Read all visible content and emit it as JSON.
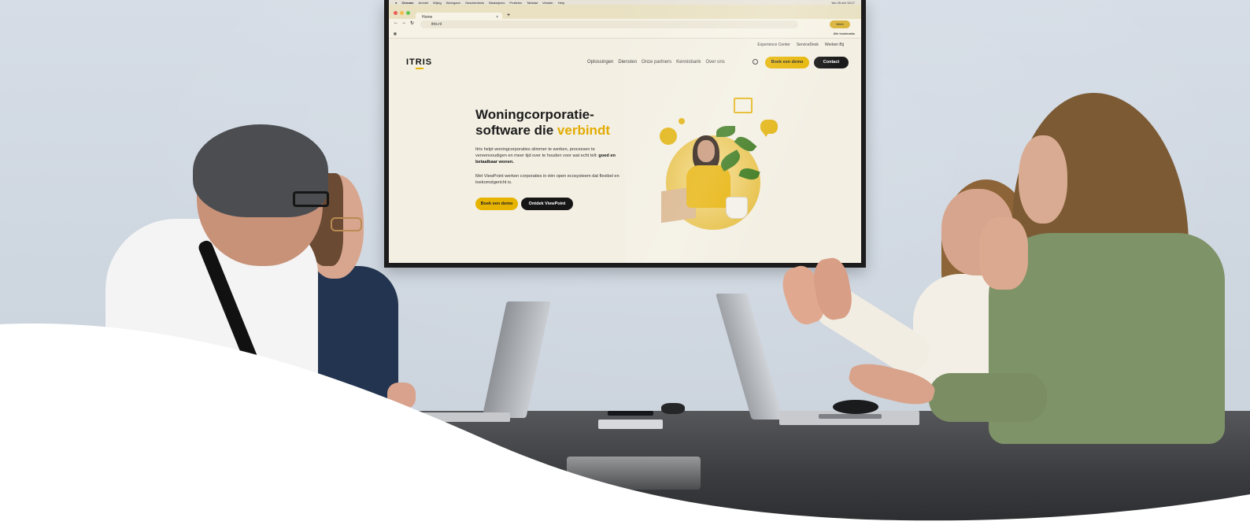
{
  "mac_menu": [
    "Chrome",
    "Archief",
    "Wijzig",
    "Weergave",
    "Geschiedenis",
    "Bladwijzers",
    "Profielen",
    "Tabblad",
    "Venster",
    "Help"
  ],
  "mac_status": "Wo 25 mrt 13:17",
  "browser": {
    "tab_title": "Home",
    "tab_close": "×",
    "new_tab": "+",
    "url": "itris.nl",
    "profile": "Werk",
    "bookmarks_label": "Alle bookmarks"
  },
  "site": {
    "logo": "ITRIS",
    "top_links": [
      "Experience Center",
      "ServiceDesk",
      "Werken Bij"
    ],
    "nav": [
      "Oplossingen",
      "Diensten",
      "Onze partners",
      "Kennisbank",
      "Over ons"
    ],
    "btn_demo": "Boek een demo",
    "btn_contact": "Contact",
    "hero": {
      "title_line1": "Woningcorporatie-",
      "title_line2_a": "software die ",
      "title_line2_b": "verbindt",
      "p1_a": "Itris helpt woningcorporaties slimmer te werken, processen te vereenvoudigen en meer tijd over te houden voor wat echt telt:",
      "p1_b": "goed en betaalbaar wonen.",
      "p2": "Met ViewPoint werken corporaties in één open ecosysteem dat flexibel en toekomstgericht is.",
      "btn_primary": "Boek een demo",
      "btn_secondary": "Ontdek ViewPoint"
    }
  },
  "colors": {
    "accent": "#e6b400",
    "dark": "#161616",
    "wall": "#d6dde6"
  }
}
